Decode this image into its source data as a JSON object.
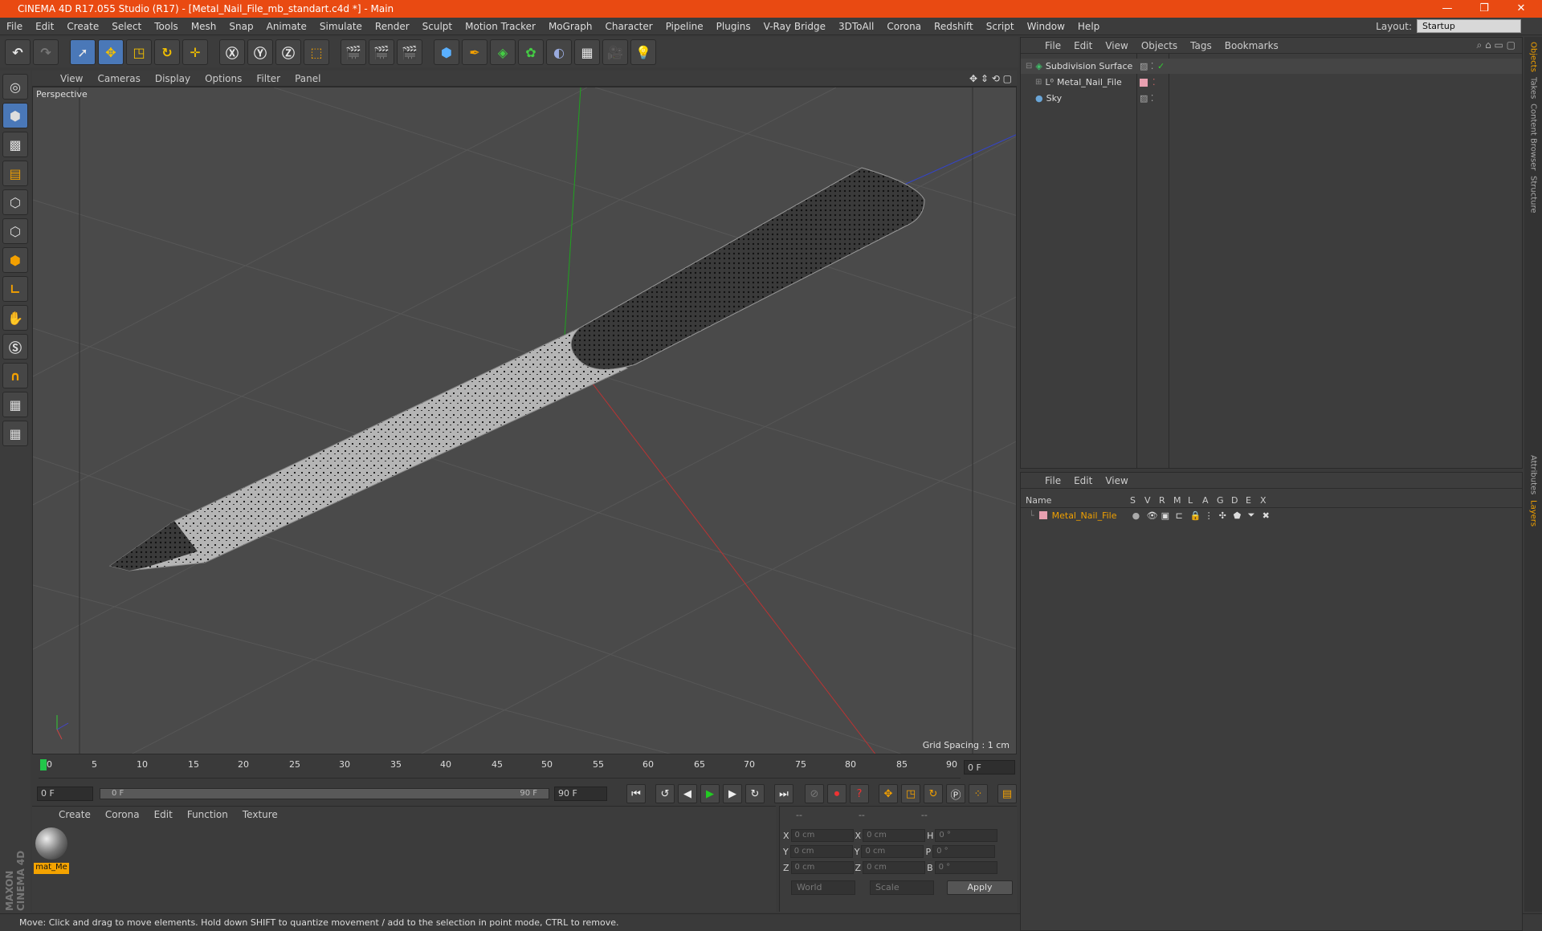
{
  "titlebar": {
    "title": "CINEMA 4D R17.055 Studio (R17) - [Metal_Nail_File_mb_standart.c4d *] - Main",
    "controls": [
      "—",
      "❐",
      "✕"
    ]
  },
  "menubar": {
    "items": [
      "File",
      "Edit",
      "Create",
      "Select",
      "Tools",
      "Mesh",
      "Snap",
      "Animate",
      "Simulate",
      "Render",
      "Sculpt",
      "Motion Tracker",
      "MoGraph",
      "Character",
      "Pipeline",
      "Plugins",
      "V-Ray Bridge",
      "3DToAll",
      "Corona",
      "Redshift",
      "Script",
      "Window",
      "Help"
    ],
    "layout_label": "Layout:",
    "layout_value": "Startup"
  },
  "viewport": {
    "menu": [
      "View",
      "Cameras",
      "Display",
      "Options",
      "Filter",
      "Panel"
    ],
    "label": "Perspective",
    "grid_spacing": "Grid Spacing : 1 cm"
  },
  "timeline": {
    "ticks": [
      "0",
      "5",
      "10",
      "15",
      "20",
      "25",
      "30",
      "35",
      "40",
      "45",
      "50",
      "55",
      "60",
      "65",
      "70",
      "75",
      "80",
      "85",
      "90"
    ],
    "current_frame": "0 F",
    "start_field": "0 F",
    "range_start": "0 F",
    "range_end": "90 F",
    "end_field": "90 F"
  },
  "material_manager": {
    "menu": [
      "Create",
      "Corona",
      "Edit",
      "Function",
      "Texture"
    ],
    "material_name": "mat_Me"
  },
  "coordinates": {
    "headers": [
      "--",
      "--",
      "--"
    ],
    "rows": [
      {
        "a": "X",
        "av": "0 cm",
        "b": "X",
        "bv": "0 cm",
        "c": "H",
        "cv": "0 °"
      },
      {
        "a": "Y",
        "av": "0 cm",
        "b": "Y",
        "bv": "0 cm",
        "c": "P",
        "cv": "0 °"
      },
      {
        "a": "Z",
        "av": "0 cm",
        "b": "Z",
        "bv": "0 cm",
        "c": "B",
        "cv": "0 °"
      }
    ],
    "mode": "World",
    "type": "Scale",
    "apply_label": "Apply"
  },
  "object_manager": {
    "menu": [
      "File",
      "Edit",
      "View",
      "Objects",
      "Tags",
      "Bookmarks"
    ],
    "objects": [
      {
        "name": "Subdivision Surface",
        "icon_color": "#41c06a"
      },
      {
        "name": "Metal_Nail_File",
        "icon_color": "#c9c9c9"
      },
      {
        "name": "Sky",
        "icon_color": "#6aa6d8"
      }
    ]
  },
  "layer_manager": {
    "menu": [
      "File",
      "Edit",
      "View"
    ],
    "columns": [
      "Name",
      "S",
      "V",
      "R",
      "M",
      "L",
      "A",
      "G",
      "D",
      "E",
      "X"
    ],
    "layer_name": "Metal_Nail_File",
    "layer_color": "#f0a000"
  },
  "side_tabs": [
    "Objects",
    "Takes",
    "Content Browser",
    "Structure",
    "Attributes",
    "Layers"
  ],
  "status": "Move: Click and drag to move elements. Hold down SHIFT to quantize movement / add to the selection in point mode, CTRL to remove.",
  "maxon_logo": "MAXON CINEMA 4D"
}
